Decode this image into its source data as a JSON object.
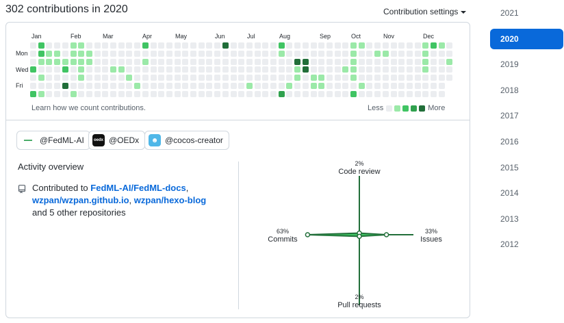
{
  "header": {
    "title": "302 contributions in 2020",
    "settings_label": "Contribution settings"
  },
  "calendar": {
    "months": [
      "Jan",
      "Feb",
      "Mar",
      "Apr",
      "May",
      "Jun",
      "Jul",
      "Aug",
      "Sep",
      "Oct",
      "Nov",
      "Dec"
    ],
    "day_labels": [
      "Mon",
      "Wed",
      "Fri"
    ],
    "learn_link": "Learn how we count contributions.",
    "legend_less": "Less",
    "legend_more": "More",
    "colors": [
      "#ebedf0",
      "#9be9a8",
      "#40c463",
      "#30a14e",
      "#216e39"
    ]
  },
  "orgs": [
    {
      "label": "@FedML-AI",
      "icon": "fedml-logo-icon"
    },
    {
      "label": "@OEDx",
      "icon": "oedx-logo-icon"
    },
    {
      "label": "@cocos-creator",
      "icon": "cocos-logo-icon"
    }
  ],
  "activity": {
    "title": "Activity overview",
    "contributed_prefix": "Contributed to",
    "repos": [
      "FedML-AI/FedML-docs",
      "wzpan/wzpan.github.io",
      "wzpan/hexo-blog"
    ],
    "sep1": ",",
    "sep2": ",",
    "suffix": "and 5 other repositories"
  },
  "radar": {
    "code_review": {
      "pct": "2%",
      "name": "Code review"
    },
    "issues": {
      "pct": "33%",
      "name": "Issues"
    },
    "pull_requests": {
      "pct": "2%",
      "name": "Pull requests"
    },
    "commits": {
      "pct": "63%",
      "name": "Commits"
    },
    "values": {
      "code_review": 2,
      "issues": 33,
      "pull_requests": 2,
      "commits": 63
    },
    "line_color": "#216e39",
    "fill_color": "#40c463"
  },
  "years": [
    "2021",
    "2020",
    "2019",
    "2018",
    "2017",
    "2016",
    "2015",
    "2014",
    "2013",
    "2012"
  ],
  "selected_year": "2020"
}
